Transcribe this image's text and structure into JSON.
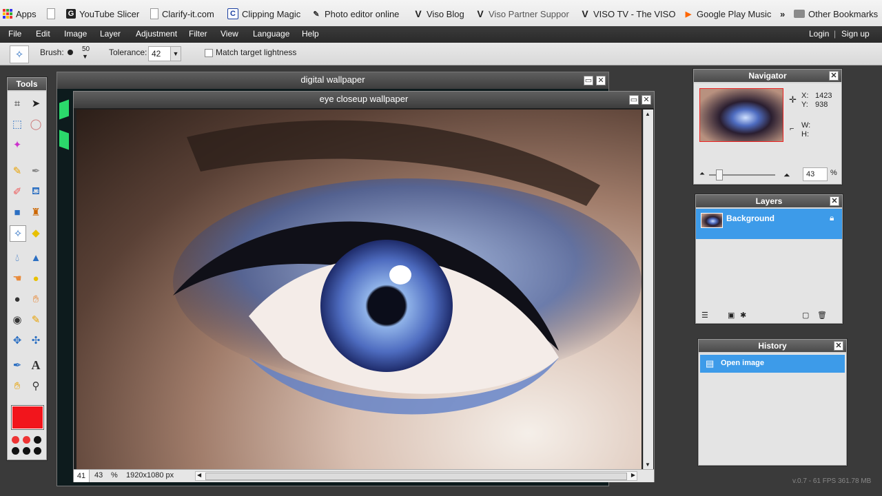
{
  "bookmarks": [
    {
      "label": "Apps",
      "icon": "apps-grid-icon"
    },
    {
      "label": "",
      "icon": "blank-page-icon"
    },
    {
      "label": "YouTube Slicer",
      "icon": "g-icon"
    },
    {
      "label": "Clarify-it.com",
      "icon": "page-icon"
    },
    {
      "label": "Clipping Magic",
      "icon": "c-icon"
    },
    {
      "label": "Photo editor online",
      "icon": "pencil-icon"
    },
    {
      "label": "Viso Blog",
      "icon": "v-icon"
    },
    {
      "label": "Viso Partner Suppor",
      "icon": "v-icon"
    },
    {
      "label": "VISO TV - The VISO",
      "icon": "v-icon"
    },
    {
      "label": "Google Play Music",
      "icon": "play-icon"
    }
  ],
  "bookmarks_more": "»",
  "other_bookmarks": "Other Bookmarks",
  "menu": [
    "File",
    "Edit",
    "Image",
    "Layer",
    "Adjustment",
    "Filter",
    "View",
    "Language",
    "Help"
  ],
  "auth": {
    "login": "Login",
    "sep": "|",
    "signup": "Sign up"
  },
  "toolbar": {
    "brush_label": "Brush:",
    "brush_size": "50",
    "tolerance_label": "Tolerance:",
    "tolerance_value": "42",
    "match_label": "Match target lightness"
  },
  "tools_title": "Tools",
  "windows": {
    "back_title": "digital wallpaper",
    "front_title": "eye closeup wallpaper"
  },
  "status": {
    "zoom_field": "41",
    "zoom_value": "43",
    "zoom_unit": "%",
    "dimensions": "1920x1080 px"
  },
  "navigator": {
    "title": "Navigator",
    "x_label": "X:",
    "x_value": "1423",
    "y_label": "Y:",
    "y_value": "938",
    "w_label": "W:",
    "h_label": "H:",
    "zoom_value": "43",
    "zoom_unit": "%"
  },
  "layers": {
    "title": "Layers",
    "items": [
      "Background"
    ]
  },
  "history": {
    "title": "History",
    "items": [
      "Open image"
    ]
  },
  "version": "v.0.7 - 61 FPS 361.78 MB",
  "colors": {
    "foreground": "#f2151c",
    "accent": "#3d9be9"
  }
}
